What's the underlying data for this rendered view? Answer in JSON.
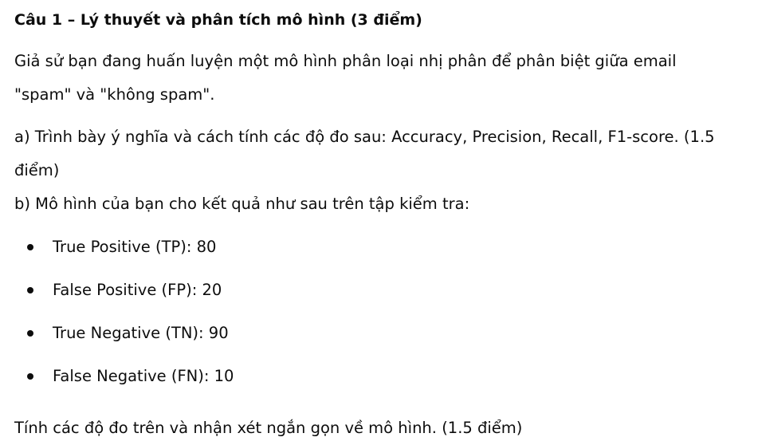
{
  "heading": "Câu 1 – Lý thuyết và phân tích mô hình (3 điểm)",
  "intro": {
    "line1": "Giả sử bạn đang huấn luyện một mô hình phân loại nhị phân để phân biệt giữa email",
    "line2": "\"spam\" và \"không spam\"."
  },
  "part_a": {
    "line1": "a) Trình bày ý nghĩa và cách tính các độ đo sau: Accuracy, Precision, Recall, F1-score. (1.5",
    "line2": "điểm)"
  },
  "part_b": "b) Mô hình của bạn cho kết quả như sau trên tập kiểm tra:",
  "bullets": [
    "True Positive (TP): 80",
    "False Positive (FP): 20",
    "True Negative (TN): 90",
    "False Negative (FN): 10"
  ],
  "closing": "Tính các độ đo trên và nhận xét ngắn gọn về mô hình. (1.5 điểm)"
}
